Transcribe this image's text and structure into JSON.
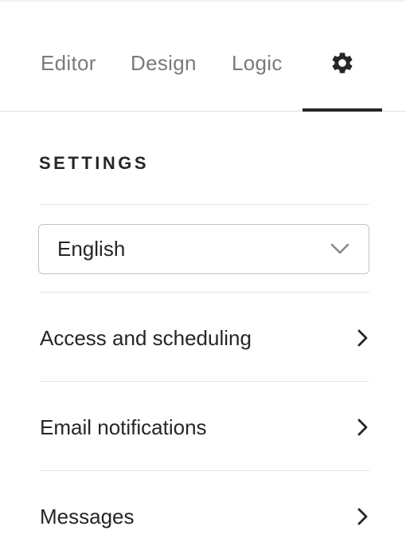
{
  "tabs": {
    "editor": "Editor",
    "design": "Design",
    "logic": "Logic",
    "settings_icon": "gear-icon",
    "active": "settings"
  },
  "settings": {
    "title": "SETTINGS",
    "language": {
      "selected": "English"
    },
    "items": [
      {
        "label": "Access and scheduling",
        "icon": "chevron-right-icon"
      },
      {
        "label": "Email notifications",
        "icon": "chevron-right-icon"
      },
      {
        "label": "Messages",
        "icon": "chevron-right-icon"
      }
    ]
  },
  "colors": {
    "text": "#262627",
    "muted_tab": "#7a7a7a",
    "divider": "#e3e3e3",
    "active_underline": "#262627"
  }
}
